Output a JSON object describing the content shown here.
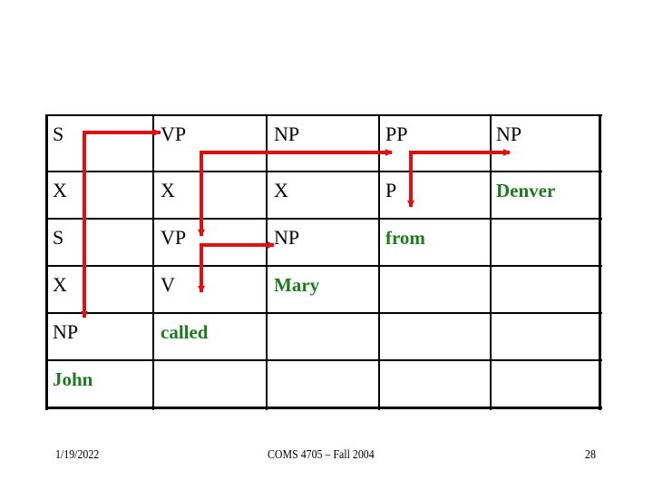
{
  "table": {
    "rows": [
      [
        {
          "text": "S",
          "kind": "category"
        },
        {
          "text": "VP",
          "kind": "category"
        },
        {
          "text": "NP",
          "kind": "category"
        },
        {
          "text": "PP",
          "kind": "category"
        },
        {
          "text": "NP",
          "kind": "category"
        }
      ],
      [
        {
          "text": "X",
          "kind": "category"
        },
        {
          "text": "X",
          "kind": "category"
        },
        {
          "text": "X",
          "kind": "category"
        },
        {
          "text": "P",
          "kind": "category"
        },
        {
          "text": "Denver",
          "kind": "word"
        }
      ],
      [
        {
          "text": "S",
          "kind": "category"
        },
        {
          "text": "VP",
          "kind": "category"
        },
        {
          "text": "NP",
          "kind": "category"
        },
        {
          "text": "from",
          "kind": "word"
        },
        {
          "text": "",
          "kind": "empty"
        }
      ],
      [
        {
          "text": "X",
          "kind": "category"
        },
        {
          "text": "V",
          "kind": "category"
        },
        {
          "text": "Mary",
          "kind": "word"
        },
        {
          "text": "",
          "kind": "empty"
        },
        {
          "text": "",
          "kind": "empty"
        }
      ],
      [
        {
          "text": "NP",
          "kind": "category"
        },
        {
          "text": "called",
          "kind": "word"
        },
        {
          "text": "",
          "kind": "empty"
        },
        {
          "text": "",
          "kind": "empty"
        },
        {
          "text": "",
          "kind": "empty"
        }
      ],
      [
        {
          "text": "John",
          "kind": "word"
        },
        {
          "text": "",
          "kind": "empty"
        },
        {
          "text": "",
          "kind": "empty"
        },
        {
          "text": "",
          "kind": "empty"
        },
        {
          "text": "",
          "kind": "empty"
        }
      ]
    ]
  },
  "arrows": [
    {
      "from": "S (row 1, col 1)",
      "to": [
        "VP (row 1, col 2)",
        "NP (row 5, col 1)"
      ]
    },
    {
      "from": "VP (row 1, col 2)",
      "to": [
        "PP (row 1, col 4)",
        "VP (row 3, col 2)"
      ]
    },
    {
      "from": "VP (row 3, col 2)",
      "to": [
        "NP (row 3, col 3)",
        "V (row 4, col 2)"
      ]
    },
    {
      "from": "PP (row 1, col 4)",
      "to": [
        "NP (row 1, col 5)",
        "P (row 2, col 4)"
      ]
    }
  ],
  "colors": {
    "arrow": "#e01010",
    "word": "#1e7a1e",
    "category": "#000000"
  },
  "footer": {
    "date": "1/19/2022",
    "course": "COMS 4705 – Fall 2004",
    "page": "28"
  }
}
